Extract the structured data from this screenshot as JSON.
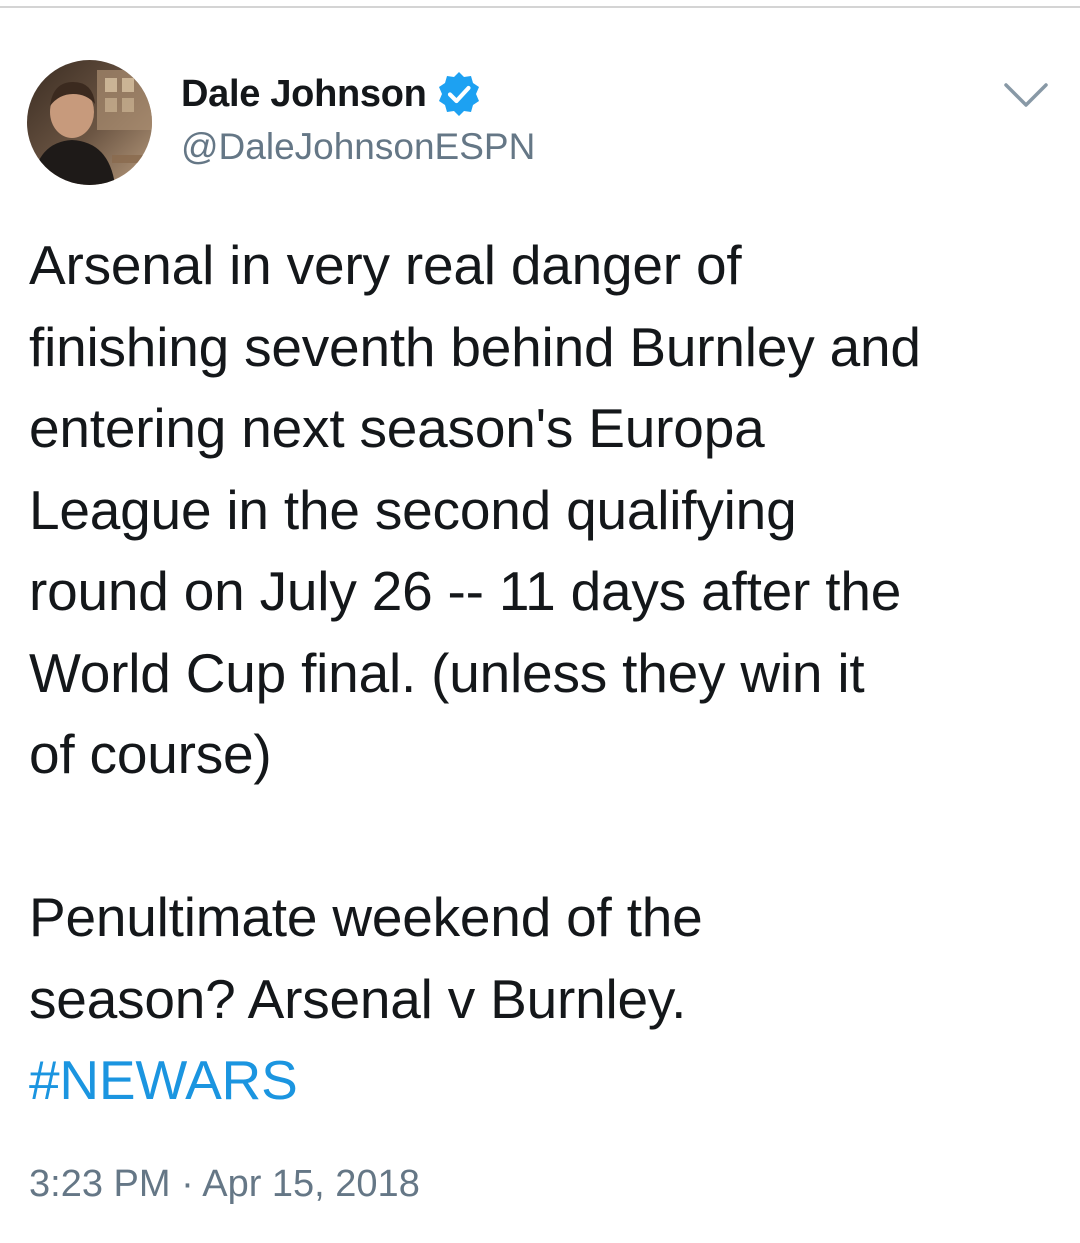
{
  "tweet": {
    "author": {
      "name": "Dale Johnson",
      "handle": "@DaleJohnsonESPN",
      "verified": true
    },
    "menu_icon": "chevron-down-icon",
    "verified_icon": "verified-badge-icon",
    "body_lines": [
      "Arsenal in very real danger of",
      "finishing seventh behind Burnley and",
      "entering next season's Europa",
      "League in the second qualifying",
      "round on July 26 -- 11 days after the",
      "World Cup final. (unless they win it",
      "of course)",
      "",
      "Penultimate weekend of the",
      "season? Arsenal v Burnley."
    ],
    "hashtag": "#NEWARS",
    "time": "3:23 PM",
    "separator": " · ",
    "date": "Apr 15, 2018"
  },
  "colors": {
    "text": "#14171a",
    "secondary_text": "#657786",
    "link": "#1b95e0",
    "verified_badge": "#1da1f2",
    "divider": "#d4d4d4"
  }
}
